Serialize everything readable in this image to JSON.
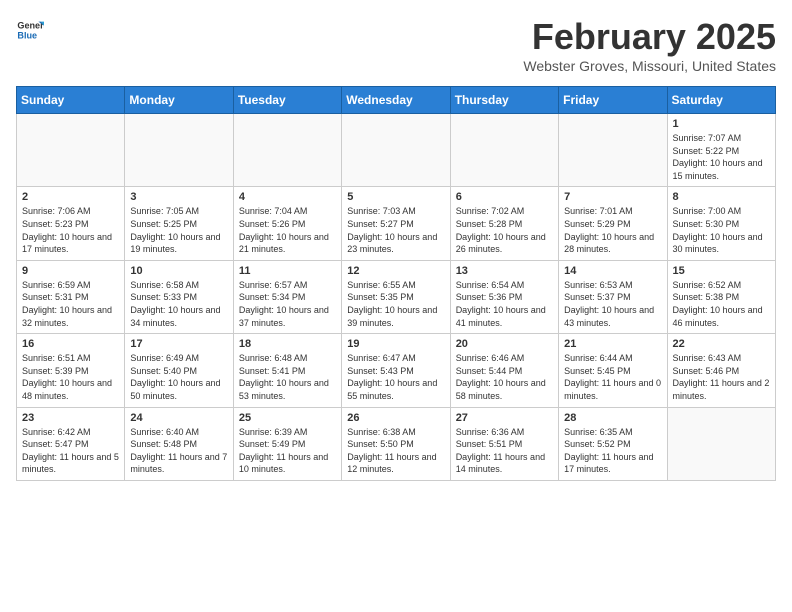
{
  "header": {
    "logo_line1": "General",
    "logo_line2": "Blue",
    "month": "February 2025",
    "location": "Webster Groves, Missouri, United States"
  },
  "weekdays": [
    "Sunday",
    "Monday",
    "Tuesday",
    "Wednesday",
    "Thursday",
    "Friday",
    "Saturday"
  ],
  "weeks": [
    [
      {
        "day": "",
        "info": ""
      },
      {
        "day": "",
        "info": ""
      },
      {
        "day": "",
        "info": ""
      },
      {
        "day": "",
        "info": ""
      },
      {
        "day": "",
        "info": ""
      },
      {
        "day": "",
        "info": ""
      },
      {
        "day": "1",
        "info": "Sunrise: 7:07 AM\nSunset: 5:22 PM\nDaylight: 10 hours and 15 minutes."
      }
    ],
    [
      {
        "day": "2",
        "info": "Sunrise: 7:06 AM\nSunset: 5:23 PM\nDaylight: 10 hours and 17 minutes."
      },
      {
        "day": "3",
        "info": "Sunrise: 7:05 AM\nSunset: 5:25 PM\nDaylight: 10 hours and 19 minutes."
      },
      {
        "day": "4",
        "info": "Sunrise: 7:04 AM\nSunset: 5:26 PM\nDaylight: 10 hours and 21 minutes."
      },
      {
        "day": "5",
        "info": "Sunrise: 7:03 AM\nSunset: 5:27 PM\nDaylight: 10 hours and 23 minutes."
      },
      {
        "day": "6",
        "info": "Sunrise: 7:02 AM\nSunset: 5:28 PM\nDaylight: 10 hours and 26 minutes."
      },
      {
        "day": "7",
        "info": "Sunrise: 7:01 AM\nSunset: 5:29 PM\nDaylight: 10 hours and 28 minutes."
      },
      {
        "day": "8",
        "info": "Sunrise: 7:00 AM\nSunset: 5:30 PM\nDaylight: 10 hours and 30 minutes."
      }
    ],
    [
      {
        "day": "9",
        "info": "Sunrise: 6:59 AM\nSunset: 5:31 PM\nDaylight: 10 hours and 32 minutes."
      },
      {
        "day": "10",
        "info": "Sunrise: 6:58 AM\nSunset: 5:33 PM\nDaylight: 10 hours and 34 minutes."
      },
      {
        "day": "11",
        "info": "Sunrise: 6:57 AM\nSunset: 5:34 PM\nDaylight: 10 hours and 37 minutes."
      },
      {
        "day": "12",
        "info": "Sunrise: 6:55 AM\nSunset: 5:35 PM\nDaylight: 10 hours and 39 minutes."
      },
      {
        "day": "13",
        "info": "Sunrise: 6:54 AM\nSunset: 5:36 PM\nDaylight: 10 hours and 41 minutes."
      },
      {
        "day": "14",
        "info": "Sunrise: 6:53 AM\nSunset: 5:37 PM\nDaylight: 10 hours and 43 minutes."
      },
      {
        "day": "15",
        "info": "Sunrise: 6:52 AM\nSunset: 5:38 PM\nDaylight: 10 hours and 46 minutes."
      }
    ],
    [
      {
        "day": "16",
        "info": "Sunrise: 6:51 AM\nSunset: 5:39 PM\nDaylight: 10 hours and 48 minutes."
      },
      {
        "day": "17",
        "info": "Sunrise: 6:49 AM\nSunset: 5:40 PM\nDaylight: 10 hours and 50 minutes."
      },
      {
        "day": "18",
        "info": "Sunrise: 6:48 AM\nSunset: 5:41 PM\nDaylight: 10 hours and 53 minutes."
      },
      {
        "day": "19",
        "info": "Sunrise: 6:47 AM\nSunset: 5:43 PM\nDaylight: 10 hours and 55 minutes."
      },
      {
        "day": "20",
        "info": "Sunrise: 6:46 AM\nSunset: 5:44 PM\nDaylight: 10 hours and 58 minutes."
      },
      {
        "day": "21",
        "info": "Sunrise: 6:44 AM\nSunset: 5:45 PM\nDaylight: 11 hours and 0 minutes."
      },
      {
        "day": "22",
        "info": "Sunrise: 6:43 AM\nSunset: 5:46 PM\nDaylight: 11 hours and 2 minutes."
      }
    ],
    [
      {
        "day": "23",
        "info": "Sunrise: 6:42 AM\nSunset: 5:47 PM\nDaylight: 11 hours and 5 minutes."
      },
      {
        "day": "24",
        "info": "Sunrise: 6:40 AM\nSunset: 5:48 PM\nDaylight: 11 hours and 7 minutes."
      },
      {
        "day": "25",
        "info": "Sunrise: 6:39 AM\nSunset: 5:49 PM\nDaylight: 11 hours and 10 minutes."
      },
      {
        "day": "26",
        "info": "Sunrise: 6:38 AM\nSunset: 5:50 PM\nDaylight: 11 hours and 12 minutes."
      },
      {
        "day": "27",
        "info": "Sunrise: 6:36 AM\nSunset: 5:51 PM\nDaylight: 11 hours and 14 minutes."
      },
      {
        "day": "28",
        "info": "Sunrise: 6:35 AM\nSunset: 5:52 PM\nDaylight: 11 hours and 17 minutes."
      },
      {
        "day": "",
        "info": ""
      }
    ]
  ]
}
